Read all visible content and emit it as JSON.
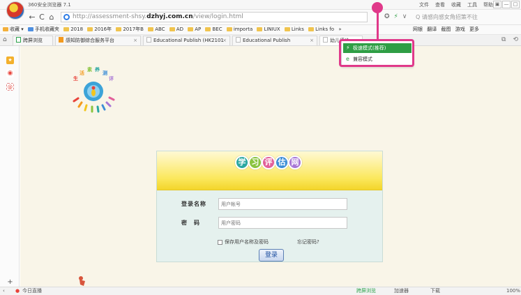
{
  "window": {
    "title": "360安全浏览器 7.1",
    "menus": [
      "文件",
      "查看",
      "收藏",
      "工具",
      "帮助"
    ],
    "controls": [
      "▣",
      "—",
      "□"
    ]
  },
  "nav": {
    "back": "←",
    "forward": "C",
    "home": "⌂",
    "url_prefix": "http://assessment-shsy.",
    "url_domain": "dzhyj.com.cn",
    "url_path": "/view/login.html",
    "icons": [
      "✪",
      "⚡",
      "∨"
    ],
    "search_placeholder": "Q 请感向感女角招策不往"
  },
  "bookmarks": {
    "items": [
      "收藏",
      "手机收藏夹",
      "2018",
      "2016年",
      "2017年B",
      "ABC",
      "AD",
      "AP",
      "BEC",
      "importa",
      "LINIUX",
      "Links",
      "Links fo"
    ],
    "more": "»",
    "right_items": [
      "网银",
      "翻译",
      "截图",
      "游戏",
      "更多"
    ]
  },
  "tabs": [
    {
      "label": "跨屏浏览",
      "type": "green"
    },
    {
      "label": "感知防御综合服务平台",
      "type": "orange"
    },
    {
      "label": "Educational Publish (HK2101",
      "type": "page"
    },
    {
      "label": "Educational Publish",
      "type": "page"
    },
    {
      "label": "幼儿评价",
      "type": "page"
    }
  ],
  "mode_menu": {
    "fast": "极速模式(推荐)",
    "compat": "兼容模式"
  },
  "login": {
    "heading_chars": [
      "学",
      "习",
      "评",
      "估",
      "网"
    ],
    "heading_colors": [
      "#2aa7a1",
      "#8ac43f",
      "#e25f9a",
      "#3d8ed6",
      "#a876d6"
    ],
    "username_label": "登录名称",
    "username_placeholder": "用户帐号",
    "password_label": "密　码",
    "password_placeholder": "用户密码",
    "remember_label": "保存用户名称及密码",
    "forgot_label": "忘记密码?",
    "submit_label": "登录"
  },
  "logo_text": "生活素养测评",
  "status": {
    "left": "今日直播",
    "right": [
      "跨屏浏览",
      "加速器",
      "下载",
      "100%"
    ]
  }
}
